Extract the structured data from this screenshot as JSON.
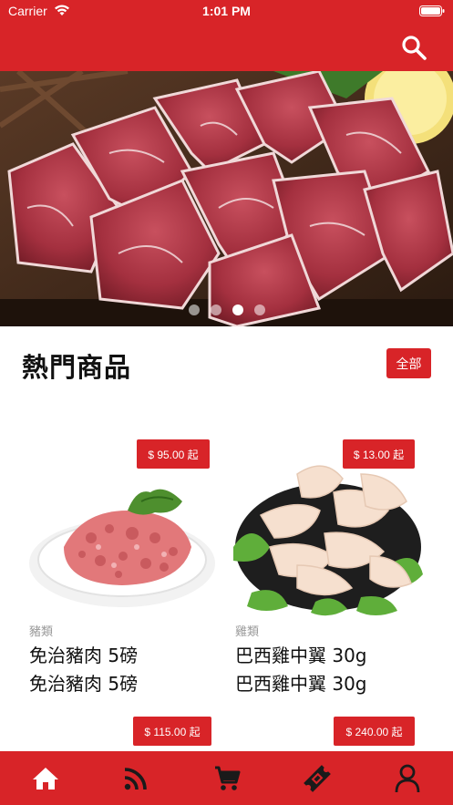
{
  "status_bar": {
    "carrier": "Carrier",
    "time": "1:01 PM"
  },
  "header": {
    "search_icon": "search-icon"
  },
  "banner": {
    "slides": 4,
    "active_index": 2
  },
  "hot_section": {
    "title": "熱門商品",
    "all_label": "全部"
  },
  "products": [
    {
      "price": "$ 95.00 起",
      "category": "豬類",
      "name": "免治豬肉 5磅",
      "name_repeat": "免治豬肉 5磅"
    },
    {
      "price": "$ 13.00 起",
      "category": "雞類",
      "name": "巴西雞中翼 30g",
      "name_repeat": "巴西雞中翼 30g"
    },
    {
      "price": "$ 115.00 起"
    },
    {
      "price": "$ 240.00 起"
    }
  ],
  "tabbar": {
    "items": [
      {
        "icon": "home-icon",
        "color": "#ffffff"
      },
      {
        "icon": "feed-icon",
        "color": "#1a1a1a"
      },
      {
        "icon": "cart-icon",
        "color": "#1a1a1a"
      },
      {
        "icon": "ticket-icon",
        "color": "#1a1a1a"
      },
      {
        "icon": "user-icon",
        "color": "#1a1a1a"
      }
    ]
  },
  "colors": {
    "brand": "#d82428"
  }
}
